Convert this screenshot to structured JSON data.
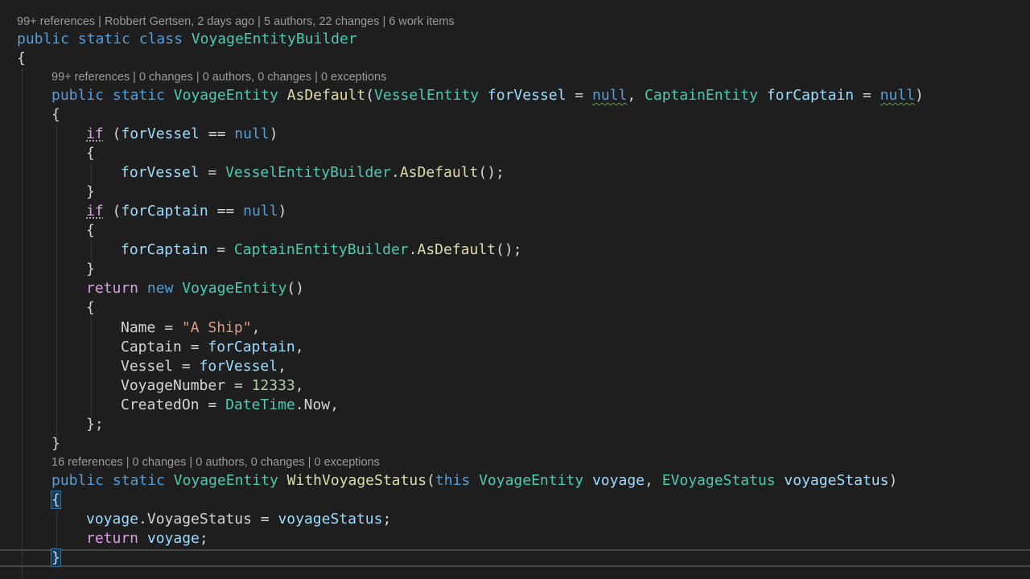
{
  "lens": {
    "class": "99+ references | Robbert Gertsen, 2 days ago | 5 authors, 22 changes | 6 work items",
    "as_default": "99+ references | 0 changes | 0 authors, 0 changes | 0 exceptions",
    "with_status": "16 references | 0 changes | 0 authors, 0 changes | 0 exceptions"
  },
  "code": {
    "kw_public": "public",
    "kw_static": "static",
    "kw_class": "class",
    "kw_if": "if",
    "kw_return": "return",
    "kw_new": "new",
    "kw_null": "null",
    "kw_this": "this",
    "class_name": "VoyageEntityBuilder",
    "t_voyage_entity": "VoyageEntity",
    "t_vessel_entity": "VesselEntity",
    "t_captain_entity": "CaptainEntity",
    "t_vessel_builder": "VesselEntityBuilder",
    "t_captain_builder": "CaptainEntityBuilder",
    "t_datetime": "DateTime",
    "t_status_enum": "EVoyageStatus",
    "m_as_default": "AsDefault",
    "m_with_status": "WithVoyageStatus",
    "p_for_vessel": "forVessel",
    "p_for_captain": "forCaptain",
    "p_voyage": "voyage",
    "p_voyage_status": "voyageStatus",
    "prop_name": "Name",
    "prop_captain": "Captain",
    "prop_vessel": "Vessel",
    "prop_voyage_number": "VoyageNumber",
    "prop_created_on": "CreatedOn",
    "prop_now": "Now",
    "prop_voyage_status": "VoyageStatus",
    "str_a_ship": "\"A Ship\"",
    "num_voyage": "12333"
  },
  "colors": {
    "background": "#1e1e1e",
    "keyword": "#569cd6",
    "control": "#d8a0df",
    "type": "#4ec9b0",
    "method": "#dcdcaa",
    "variable": "#9cdcfe",
    "string": "#d69d85",
    "number": "#b5cea8"
  }
}
